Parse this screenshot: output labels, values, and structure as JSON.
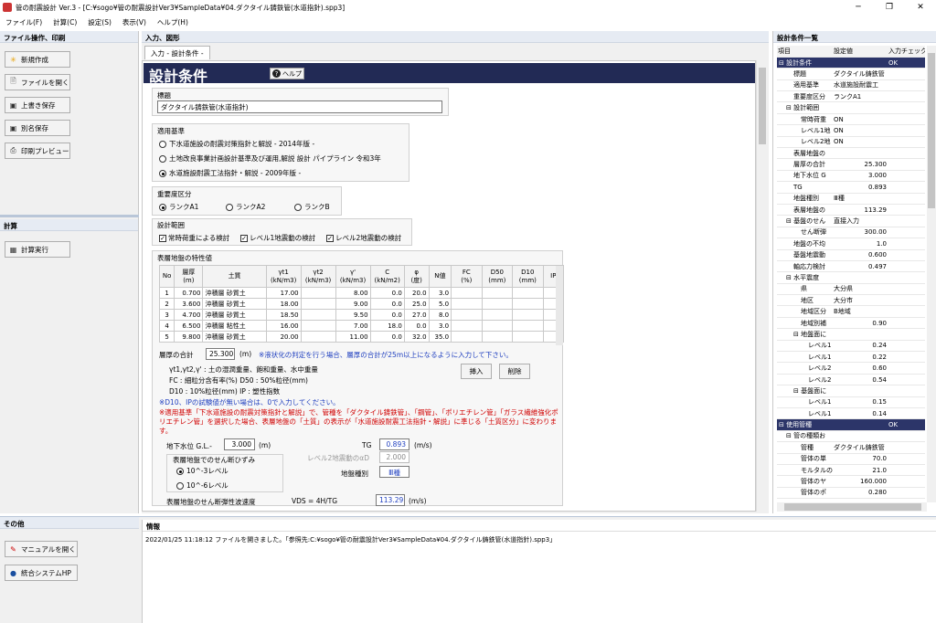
{
  "window": {
    "title": "管の耐震設計 Ver.3 - [C:¥sogo¥管の耐震設計Ver3¥SampleData¥04.ダクタイル鋳鉄管(水道指針).spp3]",
    "min": "─",
    "max": "❐",
    "close": "✕"
  },
  "menu": [
    "ファイル(F)",
    "計算(C)",
    "設定(S)",
    "表示(V)",
    "ヘルプ(H)"
  ],
  "left": {
    "file_header": "ファイル操作、印刷",
    "buttons": [
      {
        "label": "新規作成",
        "icon": "new-icon"
      },
      {
        "label": "ファイルを開く",
        "icon": "open-icon"
      },
      {
        "label": "上書き保存",
        "icon": "save-icon"
      },
      {
        "label": "別名保存",
        "icon": "saveas-icon"
      },
      {
        "label": "印刷プレビュー",
        "icon": "print-icon"
      }
    ],
    "calc_header": "計算",
    "calc_button": "計算実行",
    "other_header": "その他",
    "other_buttons": [
      "マニュアルを開く",
      "統合システムHP"
    ]
  },
  "center": {
    "header": "入力、図形",
    "tab": "入力 - 設計条件 -",
    "title": "設計条件",
    "help": "ヘルプ",
    "name_label": "標題",
    "name_value": "ダクタイル鋳鉄管(水道指針)",
    "std_label": "適用基準",
    "standards": [
      "下水道施設の耐震対策指針と解説 - 2014年版 -",
      "土地改良事業計画設計基準及び運用,解説 設計 パイプライン 令和3年",
      "水道施設耐震工法指針・解説 - 2009年版 -"
    ],
    "rank_label": "重要度区分",
    "ranks": [
      "ランクA1",
      "ランクA2",
      "ランクB"
    ],
    "range_label": "設計範囲",
    "ranges": [
      "常時荷重による検討",
      "レベル1地震動の検討",
      "レベル2地震動の検討"
    ],
    "soil_label": "表層地盤の特性値",
    "soil_headers": [
      "No",
      "層厚\n(m)",
      "土質",
      "γt1\n(kN/m3)",
      "γt2\n(kN/m3)",
      "γ'\n(kN/m3)",
      "C\n(kN/m2)",
      "φ\n(度)",
      "N値",
      "FC\n(%)",
      "D50\n(mm)",
      "D10\n(mm)",
      "IP"
    ],
    "soil_rows": [
      [
        "1",
        "0.700",
        "沖積層 砂質土",
        "17.00",
        "",
        "8.00",
        "0.0",
        "20.0",
        "3.0",
        "",
        "",
        "",
        ""
      ],
      [
        "2",
        "3.600",
        "沖積層 砂質土",
        "18.00",
        "",
        "9.00",
        "0.0",
        "25.0",
        "5.0",
        "",
        "",
        "",
        ""
      ],
      [
        "3",
        "4.700",
        "沖積層 砂質土",
        "18.50",
        "",
        "9.50",
        "0.0",
        "27.0",
        "8.0",
        "",
        "",
        "",
        ""
      ],
      [
        "4",
        "6.500",
        "沖積層 粘性土",
        "16.00",
        "",
        "7.00",
        "18.0",
        "0.0",
        "3.0",
        "",
        "",
        "",
        ""
      ],
      [
        "5",
        "9.800",
        "沖積層 砂質土",
        "20.00",
        "",
        "11.00",
        "0.0",
        "32.0",
        "35.0",
        "",
        "",
        "",
        ""
      ]
    ],
    "total_label": "層厚の合計",
    "total_value": "25.300",
    "total_unit": "(m)",
    "total_note": "※液状化の判定を行う場合、層厚の合計が25m以上になるように入力して下さい。",
    "legend1": "γt1,γt2,γ' : 土の湿潤重量、飽和重量、水中重量",
    "legend2": "FC : 細粒分含有率(%)   D50 : 50%粒径(mm)",
    "legend3": "D10 : 10%粒径(mm)   IP : 塑性指数",
    "insert": "挿入",
    "delete": "削除",
    "note_blue": "※D10、IPの試験値が無い場合は、0で入力してください。",
    "note_red": "※適用基準「下水道施設の耐震対策指針と解説」で、管種を「ダクタイル鋳鉄管」、「鋼管」、「ポリエチレン管」「ガラス繊維強化ポリエチレン管」を選択した場合、表層地盤の「土質」の表示が「水道施設耐震工法指針・解説」に準じる「土質区分」に変わります。",
    "gw_label": "地下水位 G.L.-",
    "gw_value": "3.000",
    "gw_unit": "(m)",
    "tg_label": "TG",
    "tg_value": "0.893",
    "tg_unit": "(m/s)",
    "strain_label": "表層地盤でのせん断ひずみ",
    "strain_opts": [
      "10^-3レベル",
      "10^-6レベル"
    ],
    "l2_label": "レベル2地震動のαD",
    "l2_value": "2.000",
    "ground_label": "地盤種別",
    "ground_value": "Ⅲ種",
    "vs_label": "表層地盤のせん断弾性波速度",
    "vs_formula": "VDS  =  4H/TG",
    "vs_value": "113.29",
    "vs_unit": "(m/s)"
  },
  "right": {
    "header": "設計条件一覧",
    "cols": [
      "項目",
      "設定値",
      "入力チェック"
    ],
    "rows": [
      {
        "t": "cat",
        "a": "⊟ 設計条件",
        "b": "",
        "c": "OK",
        "i": 0
      },
      {
        "t": "",
        "a": "標題",
        "b": "ダクタイル鋳鉄管",
        "c": "",
        "i": 2
      },
      {
        "t": "",
        "a": "適用基準",
        "b": "水道施設耐震工",
        "c": "",
        "i": 2
      },
      {
        "t": "",
        "a": "重要度区分",
        "b": "ランクA1",
        "c": "",
        "i": 2
      },
      {
        "t": "",
        "a": "⊟ 設計範囲",
        "b": "",
        "c": "",
        "i": 1
      },
      {
        "t": "",
        "a": "常時荷重",
        "b": "ON",
        "c": "",
        "i": 3
      },
      {
        "t": "",
        "a": "レベル1地",
        "b": "ON",
        "c": "",
        "i": 3
      },
      {
        "t": "",
        "a": "レベル2地",
        "b": "ON",
        "c": "",
        "i": 3
      },
      {
        "t": "",
        "a": "表層地盤の",
        "b": "",
        "c": "",
        "i": 2
      },
      {
        "t": "",
        "a": "層厚の合計",
        "b": "25.300",
        "c": "",
        "i": 2,
        "n": 1
      },
      {
        "t": "",
        "a": "地下水位 G",
        "b": "3.000",
        "c": "",
        "i": 2,
        "n": 1
      },
      {
        "t": "",
        "a": "TG",
        "b": "0.893",
        "c": "",
        "i": 2,
        "n": 1
      },
      {
        "t": "",
        "a": "地盤種別",
        "b": "Ⅲ種",
        "c": "",
        "i": 2
      },
      {
        "t": "",
        "a": "表層地盤の",
        "b": "113.29",
        "c": "",
        "i": 2,
        "n": 1
      },
      {
        "t": "",
        "a": "⊟ 基盤のせん",
        "b": "直接入力",
        "c": "",
        "i": 1
      },
      {
        "t": "",
        "a": "せん断弾",
        "b": "300.00",
        "c": "",
        "i": 3,
        "n": 1
      },
      {
        "t": "",
        "a": "地盤の不均",
        "b": "1.0",
        "c": "",
        "i": 2,
        "n": 1
      },
      {
        "t": "",
        "a": "基盤地震動",
        "b": "0.600",
        "c": "",
        "i": 2,
        "n": 1
      },
      {
        "t": "",
        "a": "軸応力検討",
        "b": "0.497",
        "c": "",
        "i": 2,
        "n": 1
      },
      {
        "t": "",
        "a": "⊟ 水平震度",
        "b": "",
        "c": "",
        "i": 1
      },
      {
        "t": "",
        "a": "県",
        "b": "大分県",
        "c": "",
        "i": 3
      },
      {
        "t": "",
        "a": "地区",
        "b": "大分市",
        "c": "",
        "i": 3
      },
      {
        "t": "",
        "a": "地域区分",
        "b": "B地域",
        "c": "",
        "i": 3
      },
      {
        "t": "",
        "a": "地域別補",
        "b": "0.90",
        "c": "",
        "i": 3,
        "n": 1
      },
      {
        "t": "",
        "a": "⊟ 地盤面に",
        "b": "",
        "c": "",
        "i": 2
      },
      {
        "t": "",
        "a": "レベル1",
        "b": "0.24",
        "c": "",
        "i": 4,
        "n": 1
      },
      {
        "t": "",
        "a": "レベル1",
        "b": "0.22",
        "c": "",
        "i": 4,
        "n": 1
      },
      {
        "t": "",
        "a": "レベル2",
        "b": "0.60",
        "c": "",
        "i": 4,
        "n": 1
      },
      {
        "t": "",
        "a": "レベル2",
        "b": "0.54",
        "c": "",
        "i": 4,
        "n": 1
      },
      {
        "t": "",
        "a": "⊟ 基盤面に",
        "b": "",
        "c": "",
        "i": 2
      },
      {
        "t": "",
        "a": "レベル1",
        "b": "0.15",
        "c": "",
        "i": 4,
        "n": 1
      },
      {
        "t": "",
        "a": "レベル1",
        "b": "0.14",
        "c": "",
        "i": 4,
        "n": 1
      },
      {
        "t": "cat",
        "a": "⊟ 使用管種",
        "b": "",
        "c": "OK",
        "i": 0
      },
      {
        "t": "",
        "a": "⊟ 管の種類お",
        "b": "",
        "c": "",
        "i": 1
      },
      {
        "t": "",
        "a": "管種",
        "b": "ダクタイル鋳鉄管",
        "c": "",
        "i": 3
      },
      {
        "t": "",
        "a": "管体の単",
        "b": "70.0",
        "c": "",
        "i": 3,
        "n": 1
      },
      {
        "t": "",
        "a": "モルタルの",
        "b": "21.0",
        "c": "",
        "i": 3,
        "n": 1
      },
      {
        "t": "",
        "a": "管体のヤ",
        "b": "160.000",
        "c": "",
        "i": 3,
        "n": 1
      },
      {
        "t": "",
        "a": "管体のポ",
        "b": "0.280",
        "c": "",
        "i": 3,
        "n": 1
      }
    ]
  },
  "info": {
    "header": "情報",
    "log": "2022/01/25 11:18:12 ファイルを開きました。「参照先:C:¥sogo¥管の耐震設計Ver3¥SampleData¥04.ダクタイル鋳鉄管(水道指針).spp3」"
  }
}
